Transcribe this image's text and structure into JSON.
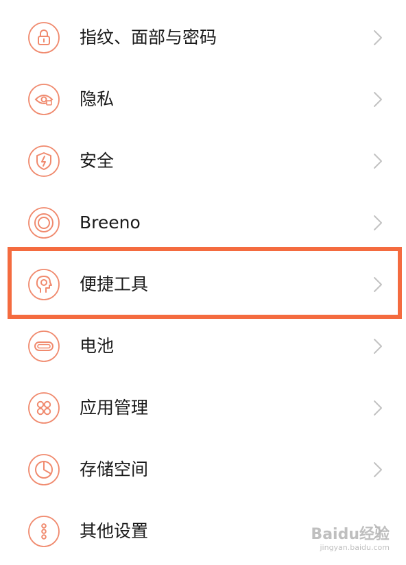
{
  "theme": {
    "accent": "#f08a6e",
    "highlight": "#f46b3f",
    "chevron": "#c2c2c2",
    "text": "#1a1a1a"
  },
  "settings": {
    "items": [
      {
        "label": "指纹、面部与密码",
        "icon": "lock-icon"
      },
      {
        "label": "隐私",
        "icon": "privacy-eye-icon"
      },
      {
        "label": "安全",
        "icon": "shield-bolt-icon"
      },
      {
        "label": "Breeno",
        "icon": "breeno-ring-icon"
      },
      {
        "label": "便捷工具",
        "icon": "head-gear-icon"
      },
      {
        "label": "电池",
        "icon": "battery-icon"
      },
      {
        "label": "应用管理",
        "icon": "app-grid-icon"
      },
      {
        "label": "存储空间",
        "icon": "storage-pie-icon"
      },
      {
        "label": "其他设置",
        "icon": "more-dots-icon"
      }
    ],
    "highlighted_item": "便捷工具"
  },
  "watermark": {
    "brand": "Baidu经验",
    "url": "jingyan.baidu.com"
  }
}
